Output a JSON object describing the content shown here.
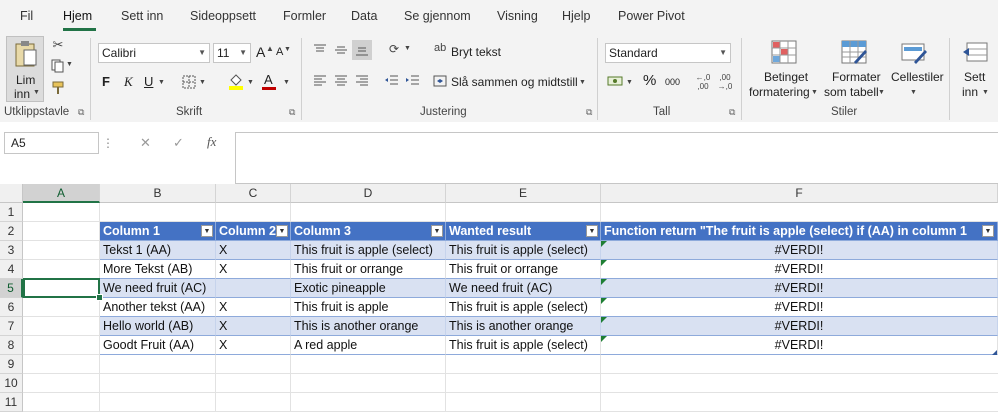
{
  "tabs": [
    {
      "label": "Fil"
    },
    {
      "label": "Hjem"
    },
    {
      "label": "Sett inn"
    },
    {
      "label": "Sideoppsett"
    },
    {
      "label": "Formler"
    },
    {
      "label": "Data"
    },
    {
      "label": "Se gjennom"
    },
    {
      "label": "Visning"
    },
    {
      "label": "Hjelp"
    },
    {
      "label": "Power Pivot"
    }
  ],
  "ribbon": {
    "clipboard": {
      "paste_line1": "Lim",
      "paste_line2": "inn",
      "label": "Utklippstavle"
    },
    "font": {
      "name": "Calibri",
      "size": "11",
      "bold": "F",
      "italic": "K",
      "underline": "U",
      "grow": "A",
      "shrink": "A",
      "font_color_letter": "A",
      "label": "Skrift"
    },
    "alignment": {
      "wrap_text": "Bryt tekst",
      "merge_center": "Slå sammen og midtstill",
      "label": "Justering"
    },
    "number": {
      "format": "Standard",
      "percent": "%",
      "comma": "000",
      "inc_dec": "←,0\n,00",
      "label": "Tall"
    },
    "styles": {
      "conditional_line1": "Betinget",
      "conditional_line2": "formatering",
      "format_table_line1": "Formater",
      "format_table_line2": "som tabell",
      "cell_styles": "Cellestiler",
      "label": "Stiler"
    },
    "cells": {
      "insert_line1": "Sett",
      "insert_line2": "inn"
    }
  },
  "formula_bar": {
    "name_box": "A5",
    "fx": "fx",
    "cancel": "✕",
    "confirm": "✓",
    "content": ""
  },
  "columns": [
    "A",
    "B",
    "C",
    "D",
    "E",
    "F"
  ],
  "rows": [
    "1",
    "2",
    "3",
    "4",
    "5",
    "6",
    "7",
    "8",
    "9",
    "10",
    "11"
  ],
  "table": {
    "headers": [
      "Column 1",
      "Column 2",
      "Column 3",
      "Wanted result",
      "Function return \"The fruit is apple (select) if (AA) in column 1"
    ],
    "rows": [
      [
        "Tekst 1 (AA)",
        "X",
        "This fruit is apple (select)",
        "This fruit is apple (select)",
        "#VERDI!"
      ],
      [
        "More Tekst (AB)",
        "X",
        "This fruit or orrange",
        "This fruit or orrange",
        "#VERDI!"
      ],
      [
        "We need fruit (AC)",
        "",
        "Exotic pineapple",
        "We need fruit (AC)",
        "#VERDI!"
      ],
      [
        "Another tekst (AA)",
        "X",
        "This fruit is apple",
        "This fruit is apple (select)",
        "#VERDI!"
      ],
      [
        "Hello world (AB)",
        "X",
        "This is another orange",
        "This is another orange",
        "#VERDI!"
      ],
      [
        "Goodt Fruit (AA)",
        "X",
        "A red apple",
        "This fruit is apple (select)",
        "#VERDI!"
      ]
    ]
  },
  "colors": {
    "accent_green": "#217346",
    "table_header": "#4472c4",
    "table_band": "#d9e1f2",
    "font_color": "#c00000",
    "highlight": "#ffff00"
  }
}
